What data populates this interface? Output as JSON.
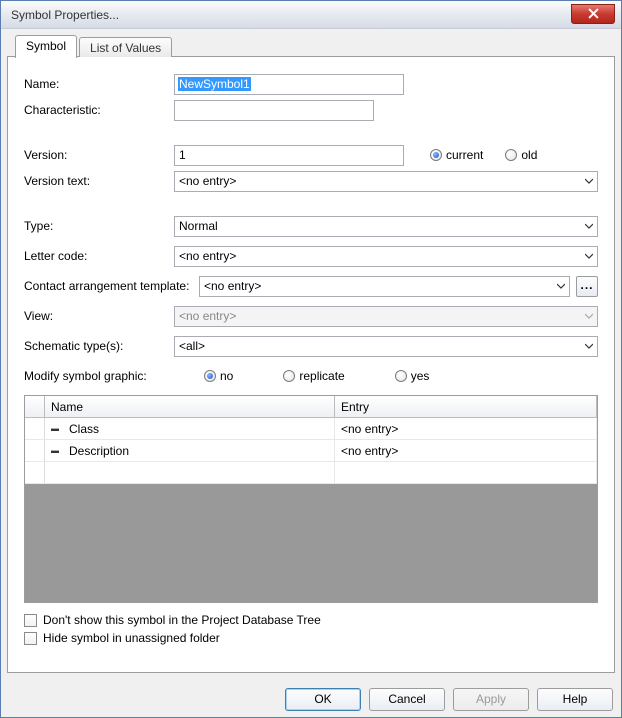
{
  "window": {
    "title": "Symbol Properties..."
  },
  "tabs": {
    "active": "Symbol",
    "inactive": "List of Values"
  },
  "labels": {
    "name": "Name:",
    "characteristic": "Characteristic:",
    "version": "Version:",
    "version_text": "Version text:",
    "type": "Type:",
    "letter_code": "Letter code:",
    "contact_template": "Contact arrangement template:",
    "view": "View:",
    "schematic_types": "Schematic type(s):",
    "modify_graphic": "Modify symbol graphic:"
  },
  "values": {
    "name": "NewSymbol1",
    "characteristic": "",
    "version": "1",
    "version_text": "<no entry>",
    "type": "Normal",
    "letter_code": "<no entry>",
    "contact_template": "<no entry>",
    "view": "<no entry>",
    "schematic_types": "<all>"
  },
  "radios": {
    "version": {
      "current": "current",
      "old": "old",
      "selected": "current"
    },
    "modify": {
      "no": "no",
      "replicate": "replicate",
      "yes": "yes",
      "selected": "no"
    }
  },
  "table": {
    "headers": {
      "name": "Name",
      "entry": "Entry"
    },
    "rows": [
      {
        "name": "Class",
        "entry": "<no entry>"
      },
      {
        "name": "Description",
        "entry": "<no entry>"
      }
    ]
  },
  "checkboxes": {
    "dont_show": "Don't show this symbol in the Project Database Tree",
    "hide_unassigned": "Hide symbol in unassigned folder"
  },
  "buttons": {
    "ok": "OK",
    "cancel": "Cancel",
    "apply": "Apply",
    "help": "Help",
    "browse": "..."
  }
}
